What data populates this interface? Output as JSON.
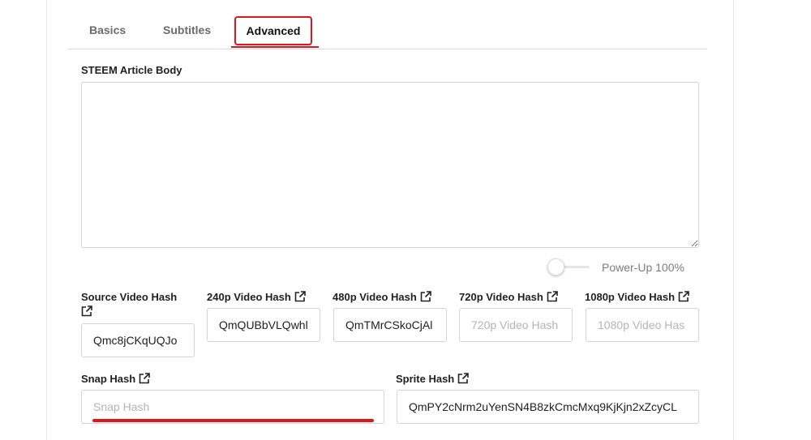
{
  "tabs": {
    "basics": "Basics",
    "subtitles": "Subtitles",
    "advanced": "Advanced"
  },
  "article": {
    "label": "STEEM Article Body",
    "value": ""
  },
  "power_up": {
    "label": "Power-Up 100%",
    "enabled": false
  },
  "hashes": {
    "source": {
      "label": "Source Video Hash",
      "value": "Qmc8jCKqUQJo",
      "placeholder": "Source Video Hash"
    },
    "p240": {
      "label": "240p Video Hash",
      "value": "QmQUBbVLQwhl",
      "placeholder": "240p Video Hash"
    },
    "p480": {
      "label": "480p Video Hash",
      "value": "QmTMrCSkoCjAl",
      "placeholder": "480p Video Hash"
    },
    "p720": {
      "label": "720p Video Hash",
      "value": "",
      "placeholder": "720p Video Hash"
    },
    "p1080": {
      "label": "1080p Video Hash",
      "value": "",
      "placeholder": "1080p Video Has"
    },
    "snap": {
      "label": "Snap Hash",
      "value": "",
      "placeholder": "Snap Hash"
    },
    "sprite": {
      "label": "Sprite Hash",
      "value": "QmPY2cNrm2uYenSN4B8zkCmcMxq9KjKjn2xZcyCL",
      "placeholder": "Sprite Hash"
    }
  },
  "icons": {
    "external_link": "external-link-icon"
  },
  "colors": {
    "accent": "#e0161d",
    "text": "#212121",
    "muted": "#6b6b6b",
    "border": "#d4d4d4"
  }
}
